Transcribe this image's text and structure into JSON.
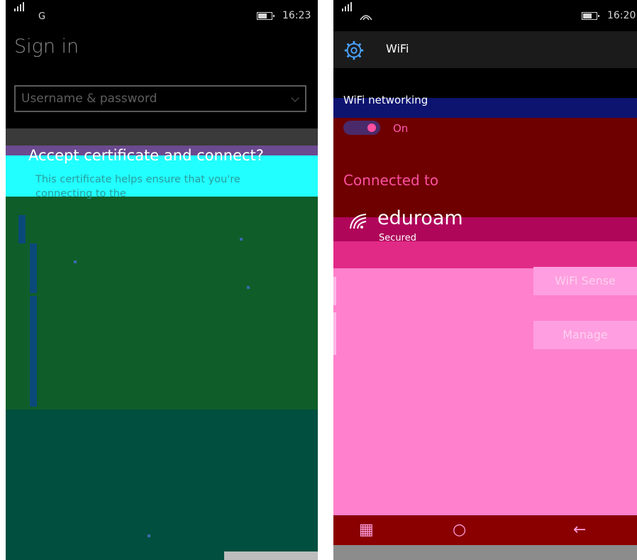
{
  "left": {
    "status": {
      "network": "G",
      "time": "16:23"
    },
    "title": "Sign in",
    "field": {
      "value": "Username & password"
    },
    "dialog": {
      "title": "Accept certificate and connect?",
      "text": "This certificate helps ensure that you're connecting to the"
    }
  },
  "right": {
    "status": {
      "time": "16:20"
    },
    "title": "WiFi",
    "section_label": "WiFi networking",
    "toggle": {
      "state": "On"
    },
    "connected_label": "Connected to",
    "network": {
      "name": "eduroam",
      "status": "Secured"
    },
    "buttons": {
      "wifi_sense": "WiFi Sense",
      "manage": "Manage"
    }
  },
  "icons": {
    "gear": "gear-icon",
    "wifi": "wifi-icon",
    "signal": "signal-icon",
    "battery": "battery-icon",
    "chevron": "chevron-down-icon"
  },
  "colors": {
    "dialog_green": "#0f5e2a",
    "cyan": "#22ffff",
    "magenta": "#ff80cc",
    "crimson": "#b0065a",
    "red": "#6e0000"
  }
}
